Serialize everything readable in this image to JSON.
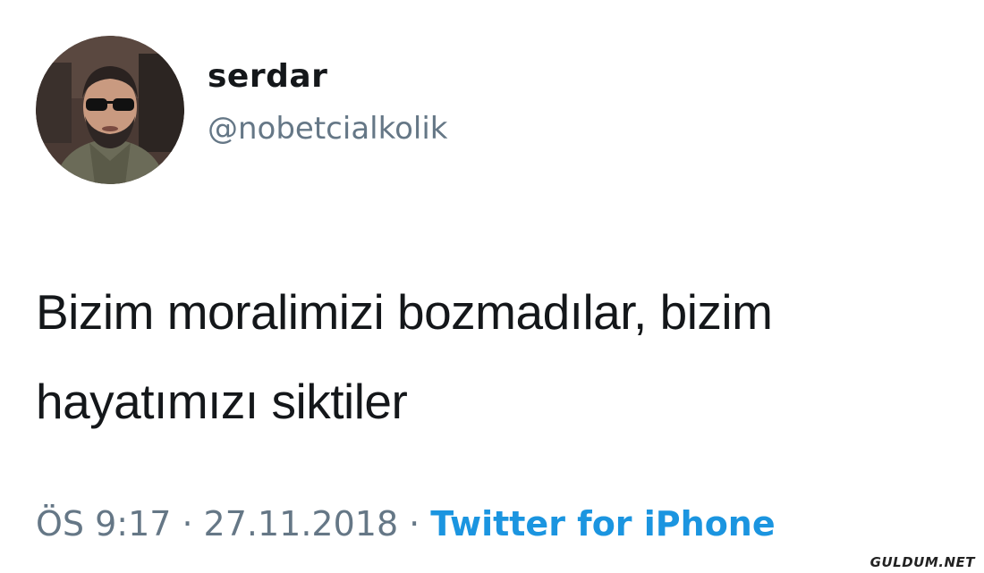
{
  "author": {
    "display_name": "serdar",
    "handle": "@nobetcialkolik"
  },
  "tweet": {
    "text_lines": [
      "Bizim moralimizi bozmadılar, bizim",
      "hayatımızı siktiler"
    ]
  },
  "meta": {
    "time": "ÖS 9:17",
    "separator": "·",
    "date": "27.11.2018",
    "source": "Twitter for iPhone"
  },
  "watermark": "GULDUM.NET",
  "colors": {
    "text": "#14171a",
    "secondary": "#657786",
    "link": "#1b95e0",
    "background": "#ffffff"
  },
  "icons": {
    "avatar": "profile-photo-avatar"
  }
}
